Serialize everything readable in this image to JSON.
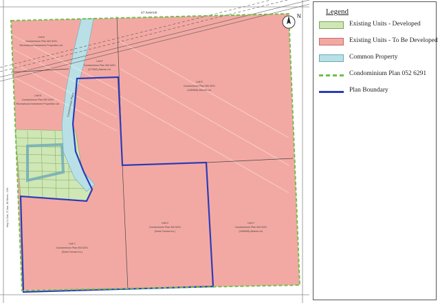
{
  "map": {
    "road_label": "47 Avenue",
    "side_road_label": "Hwy 11 Oak, 37 Ave, 38 Street - 47th",
    "common_road_label": "Condominium Place",
    "north_label": "N",
    "units": [
      {
        "unit": "Unit A",
        "plan": "Condominium Plan 052 6291",
        "owner": "Recreational Investment Properties Ltd."
      },
      {
        "unit": "Unit B",
        "plan": "Condominium Plan 052 6291",
        "owner": "Recreational Investment Properties Ltd."
      },
      {
        "unit": "Unit F",
        "plan": "Condominium Plan 052 6291",
        "owner": "(977800) Alberta Ltd."
      },
      {
        "unit": "Unit E",
        "plan": "Condominium Plan 052 6291",
        "owner": "(1180808) Alberta Ltd."
      },
      {
        "unit": "Unit C",
        "plan": "Condominium Plan 052 6291",
        "owner": "(Sobel Homes Inc.)"
      },
      {
        "unit": "Unit D",
        "plan": "Condominium Plan 052 6291",
        "owner": "(Sobel Homes Inc.)"
      },
      {
        "unit": "Unit H",
        "plan": "Condominium Plan 052 6291",
        "owner": "(1180808) Alberta Ltd."
      }
    ]
  },
  "legend": {
    "title": "Legend",
    "items": [
      {
        "label": "Existing Units - Developed",
        "swatch": "developed",
        "color": "#cfe6b5"
      },
      {
        "label": "Existing Units - To Be Developed",
        "swatch": "to-be-developed",
        "color": "#f3a9a3"
      },
      {
        "label": "Common Property",
        "swatch": "common-property",
        "color": "#b9e0e6"
      },
      {
        "label": "Condominium Plan 052 6291",
        "swatch": "condominium-plan",
        "color": "#6cc04a"
      },
      {
        "label": "Plan Boundary",
        "swatch": "plan-boundary",
        "color": "#2b3bb8"
      }
    ]
  }
}
